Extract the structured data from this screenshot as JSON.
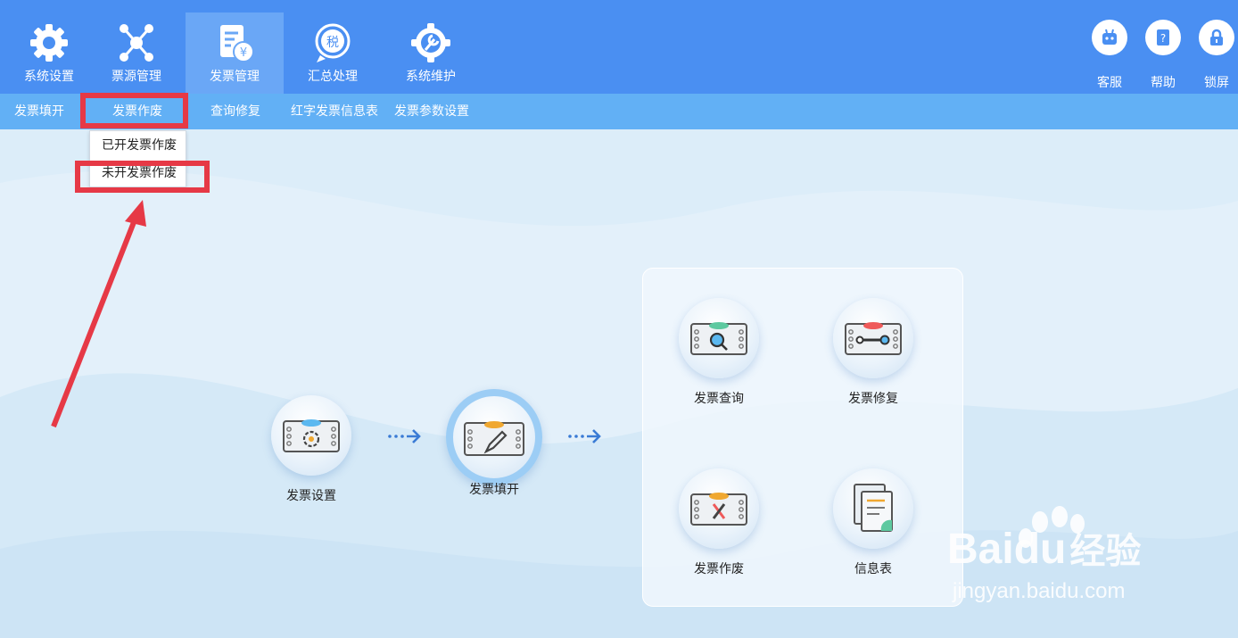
{
  "toolbar": {
    "items": [
      {
        "label": "系统设置",
        "icon": "gear-icon"
      },
      {
        "label": "票源管理",
        "icon": "network-icon"
      },
      {
        "label": "发票管理",
        "icon": "invoice-icon"
      },
      {
        "label": "汇总处理",
        "icon": "tax-summary-icon"
      },
      {
        "label": "系统维护",
        "icon": "maintenance-icon"
      }
    ],
    "active_index": 2,
    "right": [
      {
        "label": "客服",
        "icon": "robot-icon"
      },
      {
        "label": "帮助",
        "icon": "help-book-icon"
      },
      {
        "label": "锁屏",
        "icon": "lock-icon"
      }
    ]
  },
  "submenu": {
    "items": [
      "发票填开",
      "发票作废",
      "查询修复",
      "红字发票信息表",
      "发票参数设置"
    ]
  },
  "dropdown": {
    "items": [
      "已开发票作废",
      "未开发票作废"
    ]
  },
  "flow": {
    "nodes": [
      {
        "label": "发票设置",
        "icon": "invoice-settings-icon"
      },
      {
        "label": "发票填开",
        "icon": "invoice-edit-icon"
      }
    ],
    "panel": [
      {
        "label": "发票查询",
        "icon": "invoice-search-icon"
      },
      {
        "label": "发票修复",
        "icon": "invoice-repair-icon"
      },
      {
        "label": "发票作废",
        "icon": "invoice-void-icon"
      },
      {
        "label": "信息表",
        "icon": "info-sheet-icon"
      }
    ]
  },
  "watermark": {
    "brand": "Bai",
    "brand2": "du",
    "cn": "经验",
    "url": "jingyan.baidu.com"
  },
  "colors": {
    "toolbar": "#4a8ff2",
    "submenu": "#62b0f5",
    "annotation": "#e63946",
    "background": "#dcedf9"
  }
}
